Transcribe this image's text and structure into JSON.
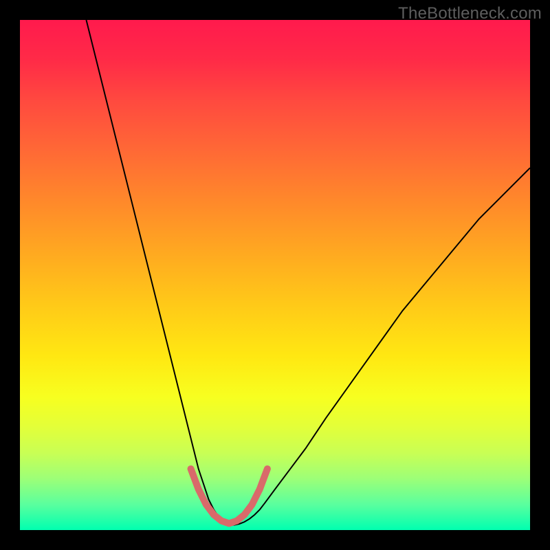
{
  "watermark": "TheBottleneck.com",
  "chart_data": {
    "type": "line",
    "title": "",
    "xlabel": "",
    "ylabel": "",
    "xlim": [
      0,
      100
    ],
    "ylim": [
      0,
      100
    ],
    "grid": false,
    "series": [
      {
        "name": "black-curve",
        "color": "#000000",
        "width": 2,
        "x": [
          13,
          15,
          17,
          19,
          21,
          23,
          25,
          27,
          29,
          31,
          32,
          33,
          34,
          35,
          36,
          37,
          38,
          39,
          40,
          41,
          42,
          43,
          44,
          45,
          46,
          47,
          48,
          50,
          53,
          56,
          60,
          65,
          70,
          75,
          80,
          85,
          90,
          95,
          100
        ],
        "y": [
          100,
          92,
          84,
          76,
          68,
          60,
          52,
          44,
          36,
          28,
          24,
          20,
          16,
          12,
          9,
          6,
          4,
          2.5,
          1.5,
          1,
          1,
          1.2,
          1.6,
          2.2,
          3,
          4,
          5.3,
          8,
          12,
          16,
          22,
          29,
          36,
          43,
          49,
          55,
          61,
          66,
          71
        ]
      },
      {
        "name": "pink-bracket",
        "color": "#d96a6a",
        "width": 10,
        "cap": "round",
        "x": [
          33.5,
          35,
          36.5,
          38,
          39.5,
          41,
          42.5,
          44,
          45.5,
          47,
          48.5
        ],
        "y": [
          12,
          8,
          5,
          3,
          1.8,
          1.3,
          1.8,
          3,
          5,
          8,
          12
        ]
      }
    ],
    "background_gradient": {
      "direction": "vertical",
      "stops": [
        {
          "pos": 0.0,
          "color": "#ff1a4d"
        },
        {
          "pos": 0.3,
          "color": "#ff7a2e"
        },
        {
          "pos": 0.6,
          "color": "#ffd815"
        },
        {
          "pos": 0.8,
          "color": "#e2ff3a"
        },
        {
          "pos": 1.0,
          "color": "#00ffb0"
        }
      ]
    }
  }
}
